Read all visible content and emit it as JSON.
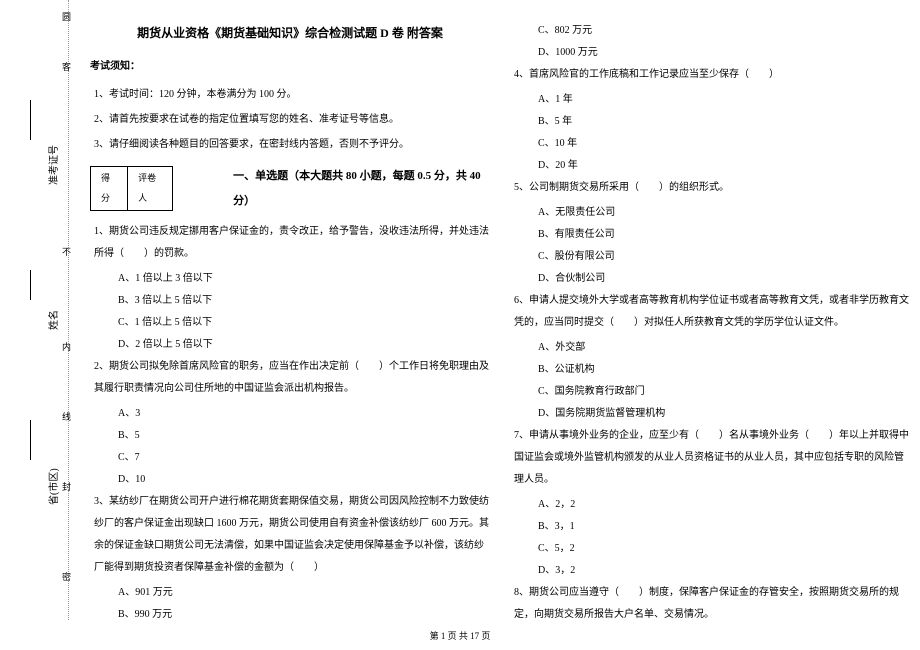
{
  "margin": {
    "char1": "圆",
    "char2": "客",
    "label1": "准考证号",
    "char3": "不",
    "label2": "姓名",
    "char4": "内",
    "char5": "线",
    "label3": "省(市区)",
    "char6": "封",
    "char7": "密"
  },
  "doc": {
    "title": "期货从业资格《期货基础知识》综合检测试题 D 卷 附答案",
    "notice_header": "考试须知：",
    "notice1": "1、考试时间：120 分钟，本卷满分为 100 分。",
    "notice2": "2、请首先按要求在试卷的指定位置填写您的姓名、准考证号等信息。",
    "notice3": "3、请仔细阅读各种题目的回答要求，在密封线内答题，否则不予评分。",
    "score_label1": "得分",
    "score_label2": "评卷人",
    "section1_title": "一、单选题（本大题共 80 小题，每题 0.5 分，共 40 分）",
    "q1": "1、期货公司违反规定挪用客户保证金的，责令改正，给予警告，没收违法所得，并处违法所得（　　）的罚款。",
    "q1a": "A、1 倍以上 3 倍以下",
    "q1b": "B、3 倍以上 5 倍以下",
    "q1c": "C、1 倍以上 5 倍以下",
    "q1d": "D、2 倍以上 5 倍以下",
    "q2": "2、期货公司拟免除首席风险官的职务，应当在作出决定前（　　）个工作日将免职理由及其履行职责情况向公司住所地的中国证监会派出机构报告。",
    "q2a": "A、3",
    "q2b": "B、5",
    "q2c": "C、7",
    "q2d": "D、10",
    "q3": "3、某纺纱厂在期货公司开户进行棉花期货套期保值交易，期货公司因风险控制不力致使纺纱厂的客户保证金出现缺口 1600 万元，期货公司使用自有资金补偿该纺纱厂 600 万元。其余的保证金缺口期货公司无法清偿，如果中国证监会决定使用保障基金予以补偿，该纺纱厂能得到期货投资者保障基金补偿的金额为（　　）",
    "q3a": "A、901 万元",
    "q3b": "B、990 万元",
    "q3c": "C、802 万元",
    "q3d": "D、1000 万元",
    "q4": "4、首席风险官的工作底稿和工作记录应当至少保存（　　）",
    "q4a": "A、1 年",
    "q4b": "B、5 年",
    "q4c": "C、10 年",
    "q4d": "D、20 年",
    "q5": "5、公司制期货交易所采用（　　）的组织形式。",
    "q5a": "A、无限责任公司",
    "q5b": "B、有限责任公司",
    "q5c": "C、股份有限公司",
    "q5d": "D、合伙制公司",
    "q6": "6、申请人提交境外大学或者高等教育机构学位证书或者高等教育文凭，或者非学历教育文凭的，应当同时提交（　　）对拟任人所获教育文凭的学历学位认证文件。",
    "q6a": "A、外交部",
    "q6b": "B、公证机构",
    "q6c": "C、国务院教育行政部门",
    "q6d": "D、国务院期货监督管理机构",
    "q7": "7、申请从事境外业务的企业，应至少有（　　）名从事境外业务（　　）年以上并取得中国证监会或境外监管机构颁发的从业人员资格证书的从业人员，其中应包括专职的风险管理人员。",
    "q7a": "A、2，2",
    "q7b": "B、3，1",
    "q7c": "C、5，2",
    "q7d": "D、3，2",
    "q8": "8、期货公司应当遵守（　　）制度，保障客户保证金的存管安全，按照期货交易所的规定，向期货交易所报告大户名单、交易情况。"
  },
  "footer": "第 1 页 共 17 页"
}
